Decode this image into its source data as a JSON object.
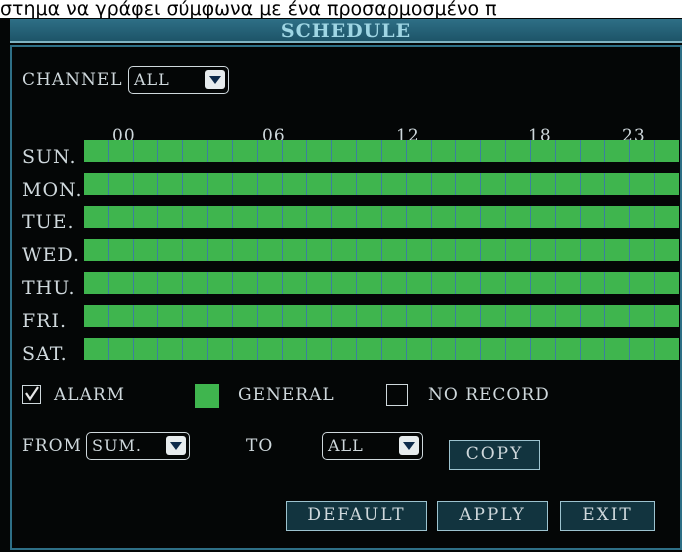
{
  "caption": "στημα να γράφει σύμφωνα με ένα προσαρμοσμένο π",
  "window": {
    "title": "SCHEDULE"
  },
  "channel": {
    "label": "CHANNEL",
    "value": "ALL"
  },
  "hours": [
    "00",
    "06",
    "12",
    "18",
    "23"
  ],
  "days": [
    {
      "label": "SUN.",
      "mode": "general"
    },
    {
      "label": "MON.",
      "mode": "general"
    },
    {
      "label": "TUE.",
      "mode": "general"
    },
    {
      "label": "WED.",
      "mode": "general"
    },
    {
      "label": "THU.",
      "mode": "general"
    },
    {
      "label": "FRI.",
      "mode": "general"
    },
    {
      "label": "SAT.",
      "mode": "general"
    }
  ],
  "slots_per_day": 24,
  "legend": {
    "alarm": {
      "label": "ALARM",
      "checked": true,
      "icon": "checkmark-icon"
    },
    "general": {
      "label": "GENERAL",
      "color": "#3fb54e"
    },
    "no_record": {
      "label": "NO RECORD"
    }
  },
  "copy": {
    "from_label": "FROM",
    "from_value": "SUM.",
    "to_label": "TO",
    "to_value": "ALL",
    "button": "COPY"
  },
  "buttons": {
    "default": "DEFAULT",
    "apply": "APPLY",
    "exit": "EXIT"
  },
  "colors": {
    "background": "#040606",
    "title_bar": "#2e6f86",
    "general": "#3fb54e",
    "grid_line": "#3c7fa0",
    "text": "#cfd8dc"
  }
}
